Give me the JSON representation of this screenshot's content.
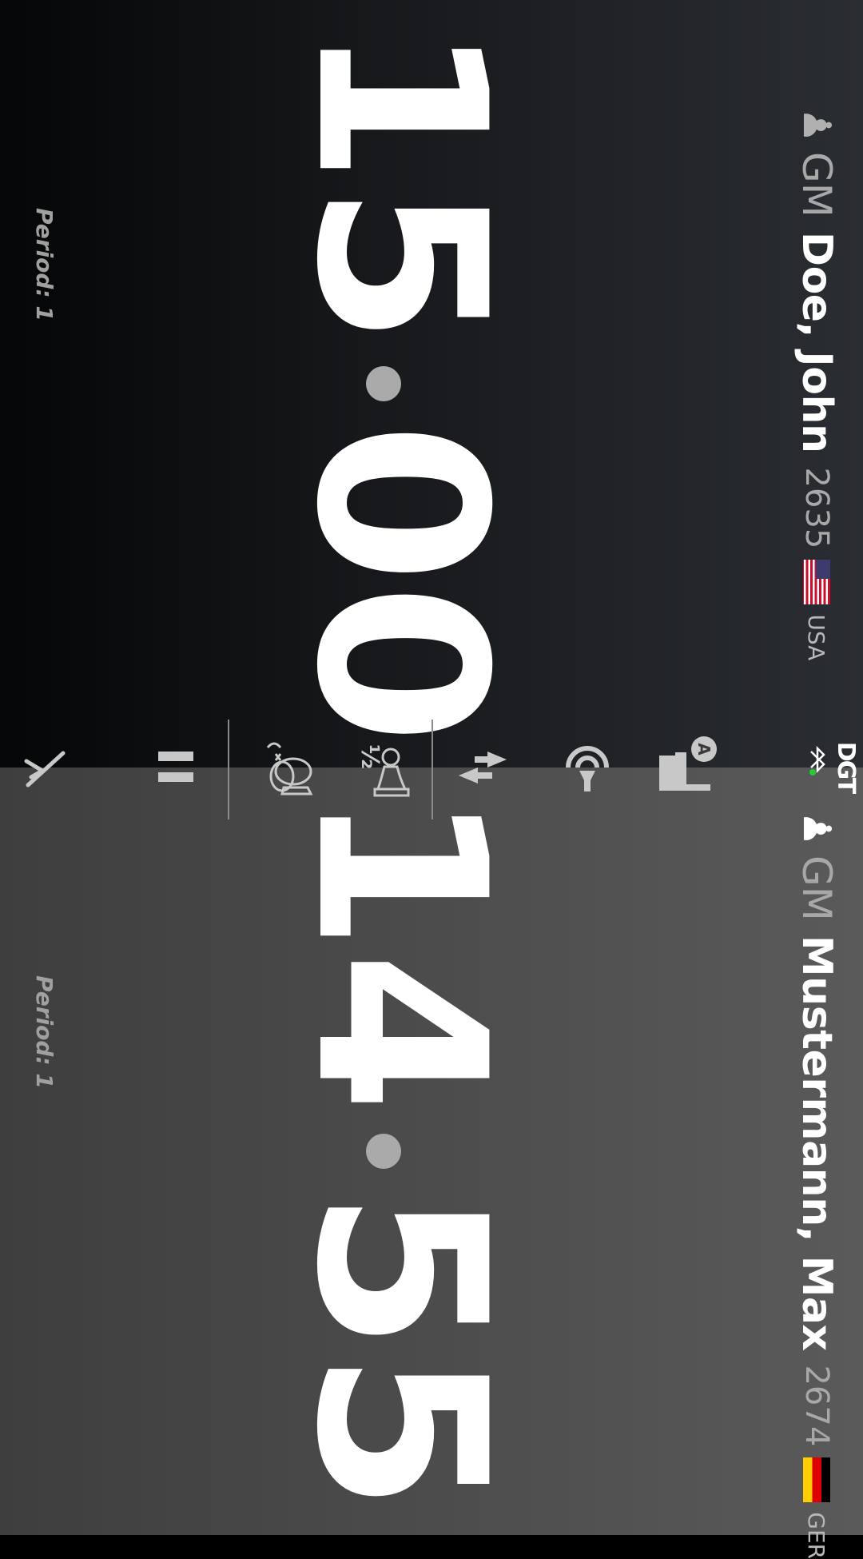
{
  "top_player": {
    "pawn_icon": "pawn-icon",
    "title": "GM",
    "name": "Doe, John",
    "rating": "2635",
    "flag_icon": "usa-flag",
    "country": "USA",
    "clock_minutes": "15",
    "clock_seconds": "00",
    "period": "Period: 1"
  },
  "bottom_player": {
    "pawn_icon": "pawn-icon",
    "title": "GM",
    "name": "Mustermann, Max",
    "rating": "2674",
    "flag_icon": "germany-flag",
    "country": "GER",
    "clock_minutes": "14",
    "clock_seconds": "55",
    "period": "Period: 1"
  },
  "toolbar": {
    "half_label": "½",
    "dgt_label": "DGT"
  },
  "colors": {
    "top_bg": "#17191c",
    "bottom_bg": "#4c4c4c",
    "icon": "#c8c8c8",
    "bluetooth_dot": "#22cc33"
  }
}
